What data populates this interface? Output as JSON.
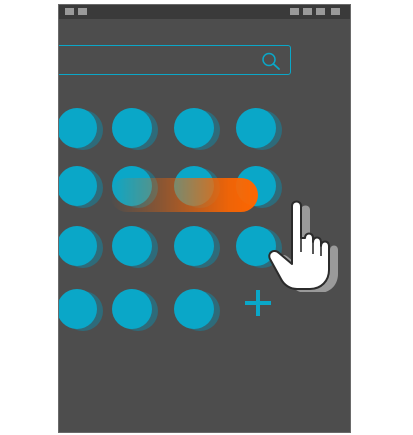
{
  "window": {
    "titlebar": {
      "left_buttons": [
        "window-control-icon",
        "window-control-icon"
      ],
      "right_buttons": [
        "window-control-icon",
        "window-control-icon",
        "window-control-icon",
        "window-control-icon"
      ]
    }
  },
  "search": {
    "value": "",
    "icon": "search-icon"
  },
  "grid": {
    "rows": [
      [
        "app-circle",
        "app-circle",
        "app-circle",
        "app-circle"
      ],
      [
        "app-circle",
        "app-circle",
        "app-circle",
        "app-circle"
      ],
      [
        "app-circle",
        "app-circle",
        "app-circle",
        "app-circle"
      ],
      [
        "app-circle",
        "app-circle",
        "app-circle",
        "plus-icon"
      ]
    ]
  },
  "gesture": {
    "icon": "hand-pointer-icon",
    "trail": "swipe-trail"
  },
  "colors": {
    "accent": "#0aa7c8",
    "background": "#4d4d4d",
    "titlebar": "#3a3a3a",
    "swipe": "#ff6600"
  }
}
